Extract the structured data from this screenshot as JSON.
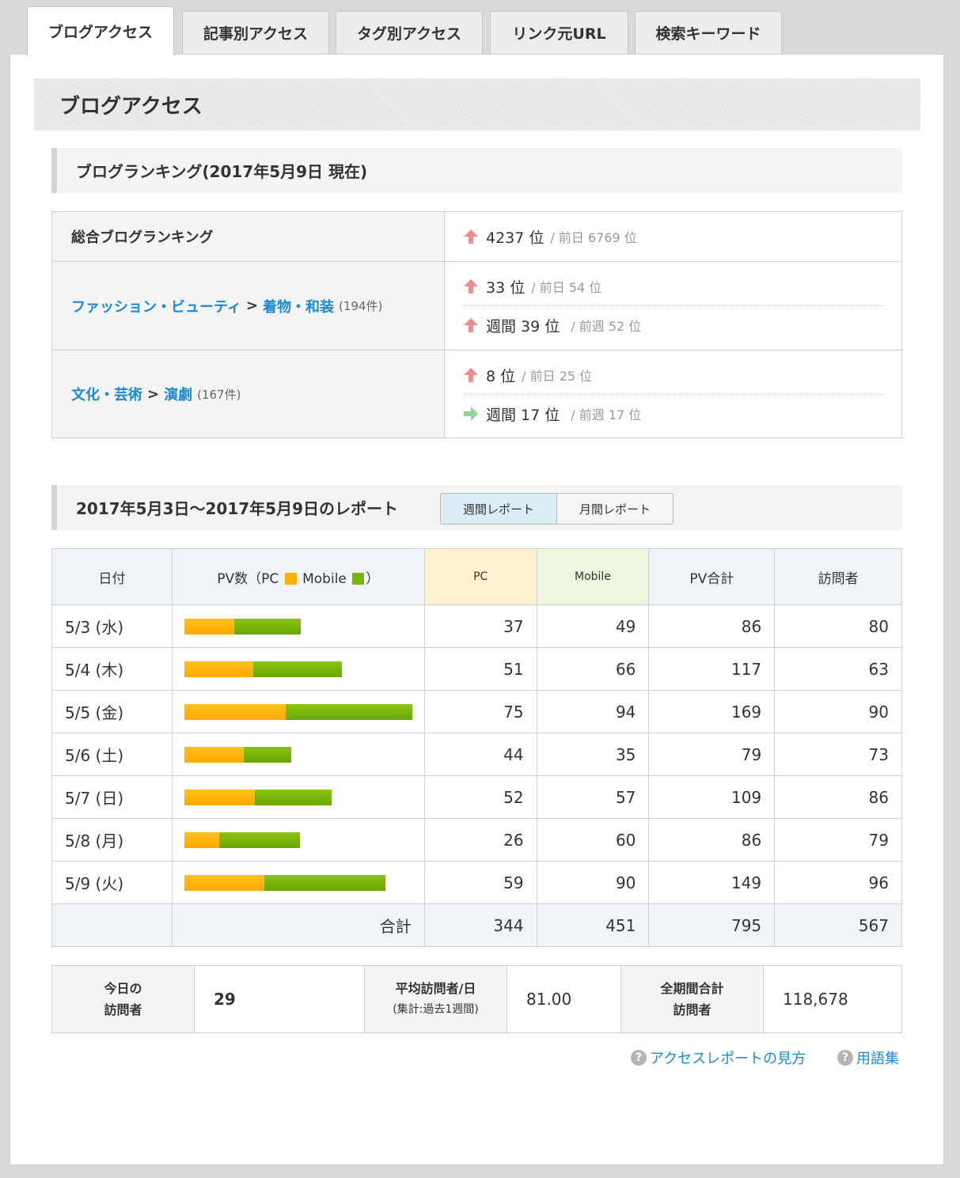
{
  "tabs": [
    {
      "label": "ブログアクセス",
      "active": true
    },
    {
      "label": "記事別アクセス"
    },
    {
      "label": "タグ別アクセス"
    },
    {
      "label": "リンク元URL"
    },
    {
      "label": "検索キーワード"
    }
  ],
  "page_title": "ブログアクセス",
  "ranking": {
    "heading": "ブログランキング(2017年5月9日 現在)",
    "overall": {
      "label": "総合ブログランキング",
      "rank": "4237 位",
      "prev": "/ 前日 6769 位"
    },
    "cat1": {
      "parent": "ファッション・ビューティ",
      "sep": ">",
      "child": "着物・和装",
      "count": "(194件)",
      "daily": "33 位",
      "daily_prev": "/ 前日 54 位",
      "weekly": "週間 39 位",
      "weekly_prev": "/ 前週 52 位"
    },
    "cat2": {
      "parent": "文化・芸術",
      "sep": ">",
      "child": "演劇",
      "count": "(167件)",
      "daily": "8 位",
      "daily_prev": "/ 前日 25 位",
      "weekly": "週間 17 位",
      "weekly_prev": "/ 前週 17 位"
    }
  },
  "report": {
    "heading": "2017年5月3日〜2017年5月9日のレポート",
    "weekly_label": "週間レポート",
    "monthly_label": "月間レポート"
  },
  "table": {
    "headers": {
      "date": "日付",
      "pv_prefix": "PV数（PC",
      "pv_mid": "Mobile",
      "pv_suffix": "）",
      "pc": "PC",
      "mobile": "Mobile",
      "total": "PV合計",
      "visitors": "訪問者"
    },
    "rows": [
      {
        "date": "5/3 (水)",
        "pc": 37,
        "mobile": 49,
        "total": 86,
        "visitors": 80
      },
      {
        "date": "5/4 (木)",
        "pc": 51,
        "mobile": 66,
        "total": 117,
        "visitors": 63
      },
      {
        "date": "5/5 (金)",
        "pc": 75,
        "mobile": 94,
        "total": 169,
        "visitors": 90
      },
      {
        "date": "5/6 (土)",
        "pc": 44,
        "mobile": 35,
        "total": 79,
        "visitors": 73
      },
      {
        "date": "5/7 (日)",
        "pc": 52,
        "mobile": 57,
        "total": 109,
        "visitors": 86
      },
      {
        "date": "5/8 (月)",
        "pc": 26,
        "mobile": 60,
        "total": 86,
        "visitors": 79
      },
      {
        "date": "5/9 (火)",
        "pc": 59,
        "mobile": 90,
        "total": 149,
        "visitors": 96
      }
    ],
    "total_label": "合計",
    "totals": {
      "pc": "344",
      "mobile": "451",
      "total": "795",
      "visitors": "567"
    }
  },
  "summary": {
    "today_l1": "今日の",
    "today_l2": "訪問者",
    "today_val": "29",
    "avg_l1": "平均訪問者/日",
    "avg_l2": "(集計:過去1週間)",
    "avg_val": "81.00",
    "all_l1": "全期間合計",
    "all_l2": "訪問者",
    "all_val": "118,678"
  },
  "help": {
    "guide": "アクセスレポートの見方",
    "glossary": "用語集",
    "icon": "?"
  },
  "colors": {
    "pc": "#ffb000",
    "mobile": "#78b40a",
    "link": "#1a8ad4",
    "up": "#f08c8c",
    "flat": "#8fd48f"
  }
}
